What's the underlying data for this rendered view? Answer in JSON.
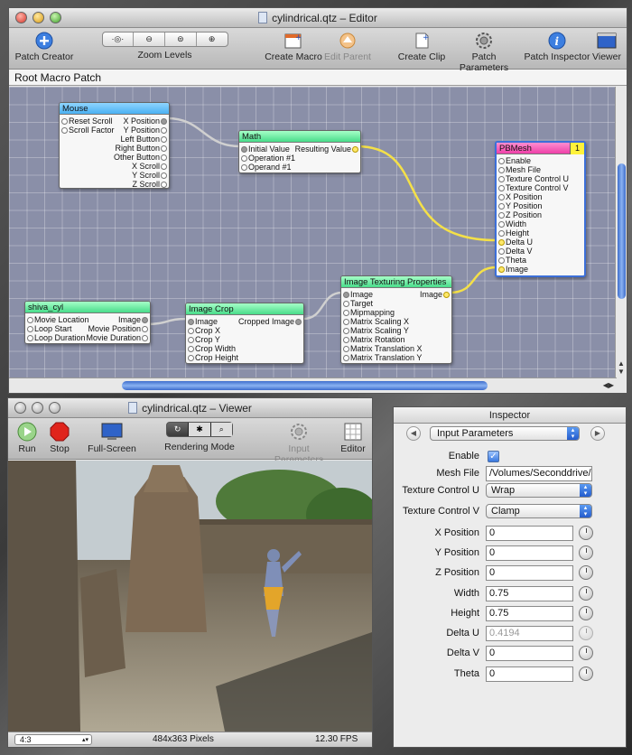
{
  "editor": {
    "title": "cylindrical.qtz – Editor",
    "toolbar": {
      "patch_creator": "Patch Creator",
      "zoom_levels": "Zoom Levels",
      "create_macro": "Create Macro",
      "edit_parent": "Edit Parent",
      "create_clip": "Create Clip",
      "patch_parameters": "Patch Parameters",
      "patch_inspector": "Patch Inspector",
      "viewer": "Viewer"
    },
    "breadcrumb": "Root Macro Patch",
    "patches": {
      "mouse": {
        "title": "Mouse",
        "inputs": [
          "Reset Scroll",
          "Scroll Factor"
        ],
        "outputs": [
          "X Position",
          "Y Position",
          "Left Button",
          "Right Button",
          "Other Button",
          "X Scroll",
          "Y Scroll",
          "Z Scroll"
        ]
      },
      "math": {
        "title": "Math",
        "inputs": [
          "Initial Value",
          "Operation #1",
          "Operand #1"
        ],
        "outputs": [
          "Resulting Value"
        ]
      },
      "pbmesh": {
        "title": "PBMesh",
        "badge": "1",
        "inputs": [
          "Enable",
          "Mesh File",
          "Texture Control U",
          "Texture Control V",
          "X Position",
          "Y Position",
          "Z Position",
          "Width",
          "Height",
          "Delta U",
          "Delta V",
          "Theta",
          "Image"
        ]
      },
      "shiva": {
        "title": "shiva_cyl",
        "inputs": [
          "Movie Location",
          "Loop Start",
          "Loop Duration"
        ],
        "outputs": [
          "Image",
          "Movie Position",
          "Movie Duration"
        ]
      },
      "crop": {
        "title": "Image Crop",
        "inputs": [
          "Image",
          "Crop X",
          "Crop Y",
          "Crop Width",
          "Crop Height"
        ],
        "outputs": [
          "Cropped Image"
        ]
      },
      "texturing": {
        "title": "Image Texturing Properties",
        "inputs": [
          "Image",
          "Target",
          "Mipmapping",
          "Matrix Scaling X",
          "Matrix Scaling Y",
          "Matrix Rotation",
          "Matrix Translation X",
          "Matrix Translation Y"
        ],
        "outputs": [
          "Image"
        ]
      }
    }
  },
  "viewer": {
    "title": "cylindrical.qtz – Viewer",
    "toolbar": {
      "run": "Run",
      "stop": "Stop",
      "fullscreen": "Full-Screen",
      "rendering_mode": "Rendering Mode",
      "input_parameters": "Input Parameters",
      "editor": "Editor"
    },
    "status": {
      "aspect": "4:3",
      "size": "484x363 Pixels",
      "fps": "12.30 FPS"
    }
  },
  "inspector": {
    "title": "Inspector",
    "mode": "Input Parameters",
    "params": {
      "enable": {
        "label": "Enable",
        "checked": true
      },
      "mesh_file": {
        "label": "Mesh File",
        "value": "/Volumes/Seconddrive/Q"
      },
      "tex_u": {
        "label": "Texture Control U",
        "value": "Wrap"
      },
      "tex_v": {
        "label": "Texture Control V",
        "value": "Clamp"
      },
      "x_pos": {
        "label": "X Position",
        "value": "0"
      },
      "y_pos": {
        "label": "Y Position",
        "value": "0"
      },
      "z_pos": {
        "label": "Z Position",
        "value": "0"
      },
      "width": {
        "label": "Width",
        "value": "0.75"
      },
      "height": {
        "label": "Height",
        "value": "0.75"
      },
      "delta_u": {
        "label": "Delta U",
        "value": "0.4194"
      },
      "delta_v": {
        "label": "Delta V",
        "value": "0"
      },
      "theta": {
        "label": "Theta",
        "value": "0"
      }
    }
  }
}
